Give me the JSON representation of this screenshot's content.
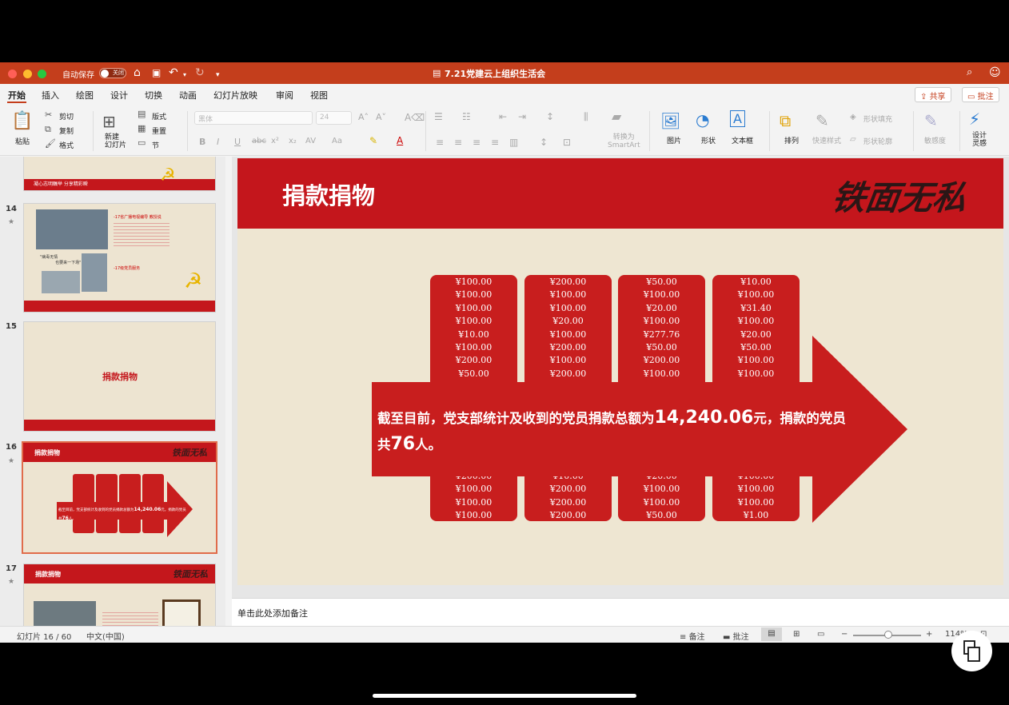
{
  "titlebar": {
    "autosave_label": "自动保存",
    "toggle_label": "关闭",
    "doc_title": "7.21党建云上组织生活会"
  },
  "tabs": [
    "开始",
    "插入",
    "绘图",
    "设计",
    "切换",
    "动画",
    "幻灯片放映",
    "审阅",
    "视图"
  ],
  "top_buttons": {
    "share": "共享",
    "comment": "批注"
  },
  "ribbon": {
    "paste": "粘贴",
    "cut": "剪切",
    "copy": "复制",
    "format": "格式",
    "new_slide": "新建\n幻灯片",
    "layout": "版式",
    "reset": "重置",
    "section": "节",
    "font_name": "黑体",
    "font_size": "24",
    "convert_smartart": "转换为\nSmartArt",
    "picture": "图片",
    "shape": "形状",
    "textbox": "文本框",
    "arrange": "排列",
    "quick_styles": "快速样式",
    "shape_fill": "形状填充",
    "shape_outline": "形状轮廓",
    "sensitivity": "敏感度",
    "design_ideas": "设计\n灵感"
  },
  "thumbnails": [
    {
      "num": "",
      "caption": "凝心志明瞩举  分享精彩瞬"
    },
    {
      "num": "14",
      "caption_a": "-17省广播电视编导 教授说",
      "caption_b": "-17级党员服务",
      "quote": "\"病毒无情\n            也要来一下场\""
    },
    {
      "num": "15",
      "title": "捐款捐物"
    },
    {
      "num": "16",
      "title": "捐款捐物",
      "summary_pre": "截至目前，党支部统计及收到的党员捐款总额为",
      "summary_amount": "14,240.06",
      "summary_mid": "元，捐款的党员",
      "summary_count": "76"
    },
    {
      "num": "17",
      "title": "捐款捐物"
    }
  ],
  "slide": {
    "title": "捐款捐物",
    "calligraphy": "铁面无私",
    "columns": [
      {
        "top": [
          "¥100.00",
          "¥100.00",
          "¥100.00",
          "¥100.00",
          "¥10.00",
          "¥100.00",
          "¥200.00",
          "¥50.00"
        ],
        "bottom": [
          "¥200.00",
          "¥100.00",
          "¥100.00",
          "¥100.00"
        ]
      },
      {
        "top": [
          "¥200.00",
          "¥100.00",
          "¥100.00",
          "¥20.00",
          "¥100.00",
          "¥200.00",
          "¥100.00",
          "¥200.00"
        ],
        "bottom": [
          "¥10.00",
          "¥200.00",
          "¥200.00",
          "¥200.00"
        ]
      },
      {
        "top": [
          "¥50.00",
          "¥100.00",
          "¥20.00",
          "¥100.00",
          "¥277.76",
          "¥50.00",
          "¥200.00",
          "¥100.00"
        ],
        "bottom": [
          "¥20.00",
          "¥100.00",
          "¥100.00",
          "¥50.00"
        ]
      },
      {
        "top": [
          "¥10.00",
          "¥100.00",
          "¥31.40",
          "¥100.00",
          "¥20.00",
          "¥50.00",
          "¥100.00",
          "¥100.00"
        ],
        "bottom": [
          "¥100.00",
          "¥100.00",
          "¥100.00",
          "¥1.00"
        ]
      }
    ],
    "summary_pre": "截至目前，党支部统计及收到的党员捐款总额为",
    "summary_amount": "14,240.06",
    "summary_mid": "元，捐款的党员",
    "summary_line2_pre": "共",
    "summary_count": "76",
    "summary_end": "人。"
  },
  "notes_placeholder": "单击此处添加备注",
  "status": {
    "slide_pos": "幻灯片 16 / 60",
    "language": "中文(中国)",
    "notes": "备注",
    "comments": "批注",
    "zoom": "114%"
  },
  "colors": {
    "accent": "#c43e1c",
    "slide_red": "#c4161c",
    "paper": "#eee6d2"
  }
}
